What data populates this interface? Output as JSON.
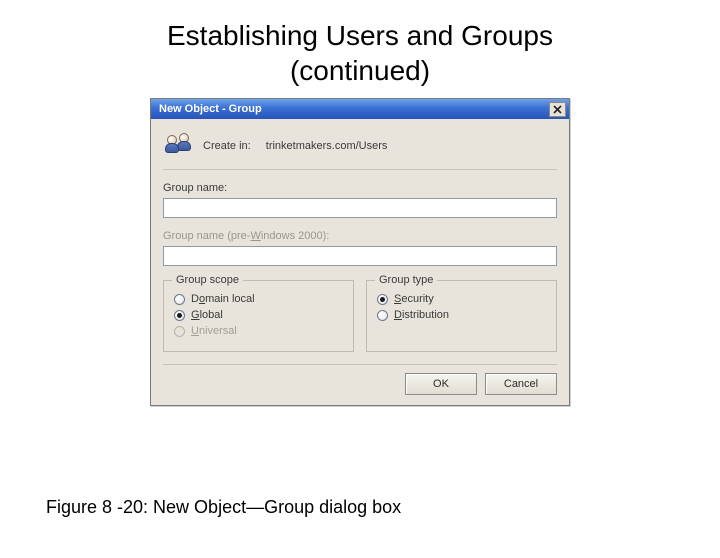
{
  "slide": {
    "title_line1": "Establishing Users and Groups",
    "title_line2": "(continued)",
    "caption": "Figure 8 -20: New Object—Group dialog box"
  },
  "dialog": {
    "title": "New Object - Group",
    "create_in_label": "Create in:",
    "create_in_path": "trinketmakers.com/Users",
    "group_name_label": "Group name:",
    "group_name_value": "",
    "pre2000_label_before": "Group name (pre-",
    "pre2000_label_ul": "W",
    "pre2000_label_after": "indows 2000):",
    "pre2000_value": "",
    "scope": {
      "legend": "Group scope",
      "domain_local_prefix": "D",
      "domain_local_ul": "o",
      "domain_local_after": "main local",
      "global_ul": "G",
      "global_after": "lobal",
      "universal_ul": "U",
      "universal_after": "niversal",
      "selected": "global"
    },
    "type": {
      "legend": "Group type",
      "security_ul": "S",
      "security_after": "ecurity",
      "distribution_ul": "D",
      "distribution_after": "istribution",
      "selected": "security"
    },
    "buttons": {
      "ok": "OK",
      "cancel": "Cancel"
    }
  }
}
